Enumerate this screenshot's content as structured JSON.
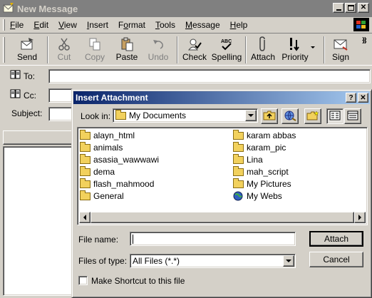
{
  "window": {
    "title": "New Message"
  },
  "menu": {
    "items": [
      {
        "pre": "",
        "key": "F",
        "post": "ile"
      },
      {
        "pre": "",
        "key": "E",
        "post": "dit"
      },
      {
        "pre": "",
        "key": "V",
        "post": "iew"
      },
      {
        "pre": "",
        "key": "I",
        "post": "nsert"
      },
      {
        "pre": "F",
        "key": "o",
        "post": "rmat"
      },
      {
        "pre": "",
        "key": "T",
        "post": "ools"
      },
      {
        "pre": "",
        "key": "M",
        "post": "essage"
      },
      {
        "pre": "",
        "key": "H",
        "post": "elp"
      }
    ],
    "chevron": "»"
  },
  "toolbar": {
    "send": "Send",
    "cut": "Cut",
    "copy": "Copy",
    "paste": "Paste",
    "undo": "Undo",
    "check": "Check",
    "spelling": "Spelling",
    "attach": "Attach",
    "priority": "Priority",
    "sign": "Sign",
    "chevron": "»"
  },
  "header": {
    "to_label": "To:",
    "cc_label": "Cc:",
    "subject_label": "Subject:"
  },
  "dialog": {
    "title": "Insert Attachment",
    "help_glyph": "?",
    "close_glyph": "✕",
    "look_in_label": "Look in:",
    "look_in_value": "My Documents",
    "files_left": [
      "alayn_html",
      "animals",
      "asasia_wawwawi",
      "dema",
      "flash_mahmood",
      "General"
    ],
    "files_right": [
      "karam abbas",
      "karam_pic",
      "Lina",
      "mah_script",
      "My Pictures",
      "My Webs"
    ],
    "file_name_label": "File name:",
    "file_name_value": "",
    "files_of_type_label": "Files of type:",
    "files_of_type_value": "All Files (*.*)",
    "attach_button": "Attach",
    "cancel_button": "Cancel",
    "shortcut_label": "Make Shortcut to this file"
  }
}
